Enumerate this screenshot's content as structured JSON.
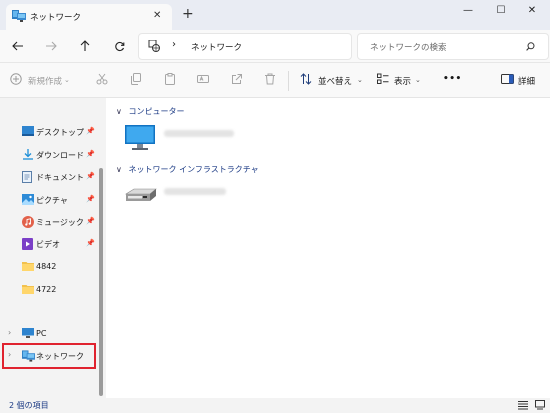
{
  "window": {
    "tab_title": "ネットワーク",
    "tab_close": "✕",
    "new_tab": "+",
    "controls": {
      "minimize": "—",
      "maximize": "☐",
      "close": "✕"
    }
  },
  "addressbar": {
    "separator": "›",
    "location": "ネットワーク",
    "search_placeholder": "ネットワークの検索"
  },
  "commandbar": {
    "new_label": "新規作成",
    "sort_label": "並べ替え",
    "view_label": "表示",
    "more_label": "•••",
    "details_label": "詳細"
  },
  "sidebar": {
    "quick_access": [
      {
        "label": "デスクトップ",
        "icon": "desktop-icon",
        "pin": "📌"
      },
      {
        "label": "ダウンロード",
        "icon": "download-icon",
        "pin": "📌"
      },
      {
        "label": "ドキュメント",
        "icon": "documents-icon",
        "pin": "📌"
      },
      {
        "label": "ピクチャ",
        "icon": "pictures-icon",
        "pin": "📌"
      },
      {
        "label": "ミュージック",
        "icon": "music-icon",
        "pin": "📌"
      },
      {
        "label": "ビデオ",
        "icon": "videos-icon",
        "pin": "📌"
      },
      {
        "label": "4842",
        "icon": "folder-icon"
      },
      {
        "label": "4722",
        "icon": "folder-icon"
      }
    ],
    "pc_label": "PC",
    "network_label": "ネットワーク"
  },
  "content": {
    "groups": [
      {
        "title": "コンピューター",
        "chevron": "∨"
      },
      {
        "title": "ネットワーク インフラストラクチャ",
        "chevron": "∨"
      }
    ]
  },
  "statusbar": {
    "item_count": "2 個の項目"
  },
  "colors": {
    "highlight": "#e0232f",
    "accent": "#1b3a84",
    "title_bg": "#e9ecf3"
  }
}
